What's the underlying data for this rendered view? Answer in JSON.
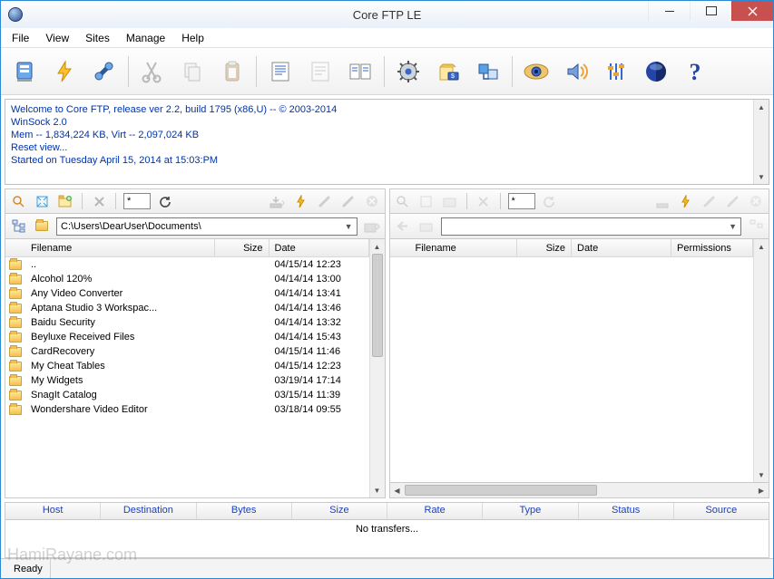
{
  "window": {
    "title": "Core FTP LE"
  },
  "menubar": [
    "File",
    "View",
    "Sites",
    "Manage",
    "Help"
  ],
  "log": {
    "lines": [
      "Welcome to Core FTP, release ver 2.2, build 1795 (x86,U) -- © 2003-2014",
      "WinSock 2.0",
      "Mem -- 1,834,224 KB, Virt -- 2,097,024 KB",
      "Reset view...",
      "Started on Tuesday April 15, 2014 at 15:03:PM"
    ]
  },
  "local": {
    "filter": "*",
    "path": "C:\\Users\\DearUser\\Documents\\",
    "columns": {
      "name": "Filename",
      "size": "Size",
      "date": "Date"
    },
    "rows": [
      {
        "name": "..",
        "size": "",
        "date": "04/15/14  12:23"
      },
      {
        "name": "Alcohol 120%",
        "size": "",
        "date": "04/14/14  13:00"
      },
      {
        "name": "Any Video Converter",
        "size": "",
        "date": "04/14/14  13:41"
      },
      {
        "name": "Aptana Studio 3 Workspac...",
        "size": "",
        "date": "04/14/14  13:46"
      },
      {
        "name": "Baidu Security",
        "size": "",
        "date": "04/14/14  13:32"
      },
      {
        "name": "Beyluxe Received Files",
        "size": "",
        "date": "04/14/14  15:43"
      },
      {
        "name": "CardRecovery",
        "size": "",
        "date": "04/15/14  11:46"
      },
      {
        "name": "My Cheat Tables",
        "size": "",
        "date": "04/15/14  12:23"
      },
      {
        "name": "My Widgets",
        "size": "",
        "date": "03/19/14  17:14"
      },
      {
        "name": "SnagIt Catalog",
        "size": "",
        "date": "03/15/14  11:39"
      },
      {
        "name": "Wondershare Video Editor",
        "size": "",
        "date": "03/18/14  09:55"
      }
    ]
  },
  "remote": {
    "filter": "*",
    "path": "",
    "columns": {
      "name": "Filename",
      "size": "Size",
      "date": "Date",
      "perm": "Permissions"
    }
  },
  "transfers": {
    "columns": [
      "Host",
      "Destination",
      "Bytes",
      "Size",
      "Rate",
      "Type",
      "Status",
      "Source"
    ],
    "empty": "No transfers..."
  },
  "status": {
    "text": "Ready"
  },
  "watermark": "HamiRayane.com"
}
